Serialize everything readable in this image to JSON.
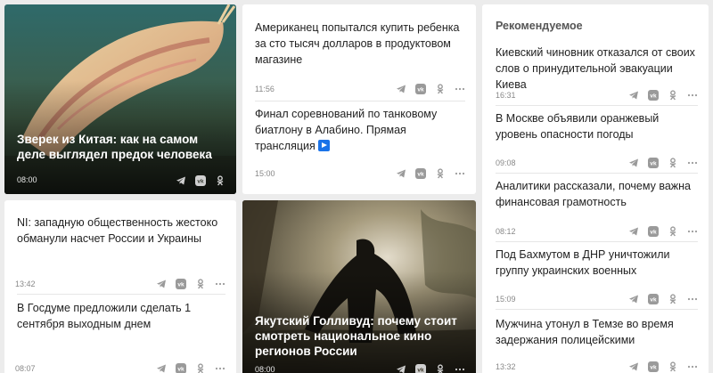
{
  "card_creature": {
    "title": "Зверек из Китая: как на самом деле выглядел предок человека",
    "time": "08:00"
  },
  "card_american": {
    "title": "Американец попытался купить ребенка за сто тысяч долларов в продуктовом магазине",
    "time": "11:56"
  },
  "card_biathlon": {
    "title": "Финал соревнований по танковому биатлону в Алабино. Прямая трансляция",
    "time": "15:00"
  },
  "card_ni": {
    "title": "NI: западную общественность жестоко обманули насчет России и Украины",
    "time": "13:42"
  },
  "card_duma": {
    "title": "В Госдуме предложили сделать 1 сентября выходным днем",
    "time": "08:07"
  },
  "card_yakut": {
    "title": "Якутский Голливуд: почему стоит смотреть национальное кино регионов России",
    "time": "08:00"
  },
  "recommended": {
    "heading": "Рекомендуемое",
    "items": [
      {
        "title": "Киевский чиновник отказался от своих слов о принудительной эвакуации Киева",
        "time": "16:31"
      },
      {
        "title": "В Москве объявили оранжевый уровень опасности погоды",
        "time": "09:08"
      },
      {
        "title": "Аналитики рассказали, почему важна финансовая грамотность",
        "time": "08:12"
      },
      {
        "title": "Под Бахмутом в ДНР уничтожили группу украинских военных",
        "time": "15:09"
      },
      {
        "title": "Мужчина утонул в Темзе во время задержания полицейскими",
        "time": "13:32"
      }
    ]
  },
  "icons": {
    "telegram": "telegram-icon",
    "vk": "vk-icon",
    "ok": "odnoklassniki-icon",
    "more": "more-icon"
  },
  "colors": {
    "background": "#ececec",
    "card": "#ffffff",
    "icon": "#9a9a9a",
    "video_badge": "#1a73e8"
  }
}
